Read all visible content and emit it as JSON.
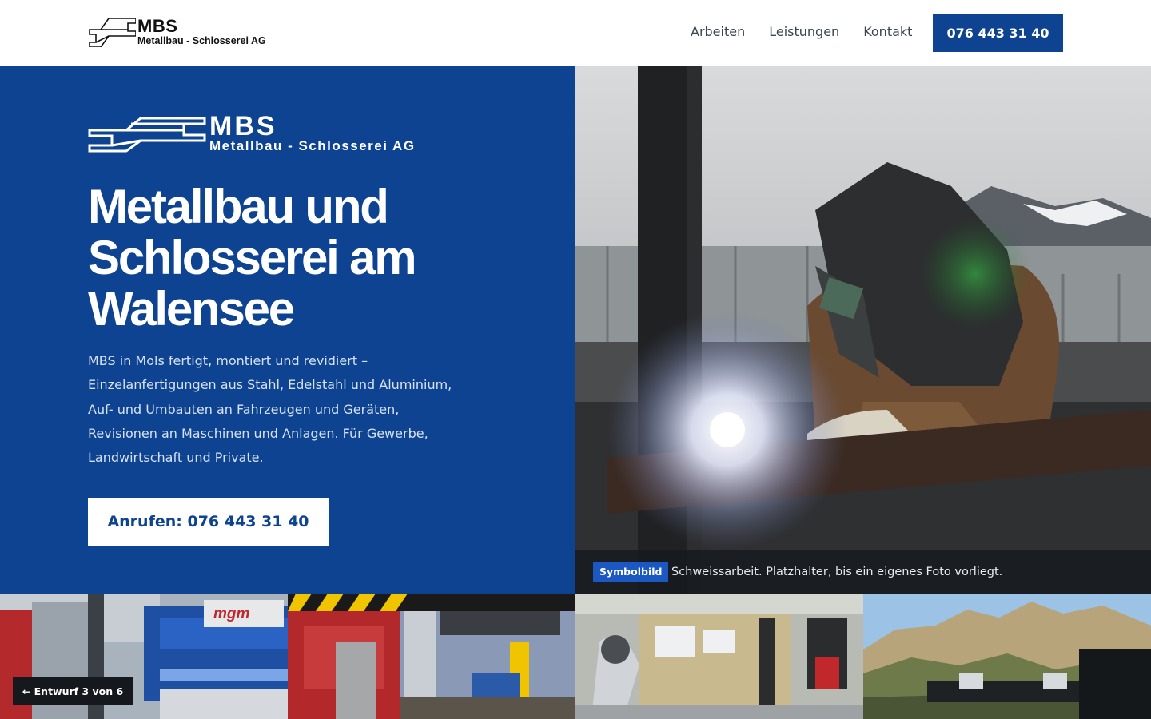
{
  "header": {
    "logo_name": "MBS",
    "logo_sub": "Metallbau - Schlosserei AG",
    "nav": [
      "Arbeiten",
      "Leistungen",
      "Kontakt"
    ],
    "phone": "076 443 31 40"
  },
  "hero": {
    "logo_name": "MBS",
    "logo_sub": "Metallbau - Schlosserei AG",
    "title": "Metallbau und Schlosserei am Walensee",
    "text": "MBS in Mols fertigt, montiert und revidiert – Einzelanfertigungen aus Stahl, Edelstahl und Aluminium, Auf- und Umbauten an Fahrzeugen und Geräten, Revisionen an Maschinen und Anlagen. Für Gewerbe, Landwirtschaft und Private.",
    "cta": "Anrufen: 076 443 31 40"
  },
  "photo": {
    "badge": "Symbolbild",
    "caption": "Schweissarbeit. Platzhalter, bis ein eigenes Foto vorliegt."
  },
  "gallery": {
    "tile1_brand": "mgm"
  },
  "draft": {
    "label": "← Entwurf 3 von 6"
  },
  "colors": {
    "brand_blue": "#0d4391",
    "badge_blue": "#1b58c2",
    "white": "#ffffff"
  }
}
